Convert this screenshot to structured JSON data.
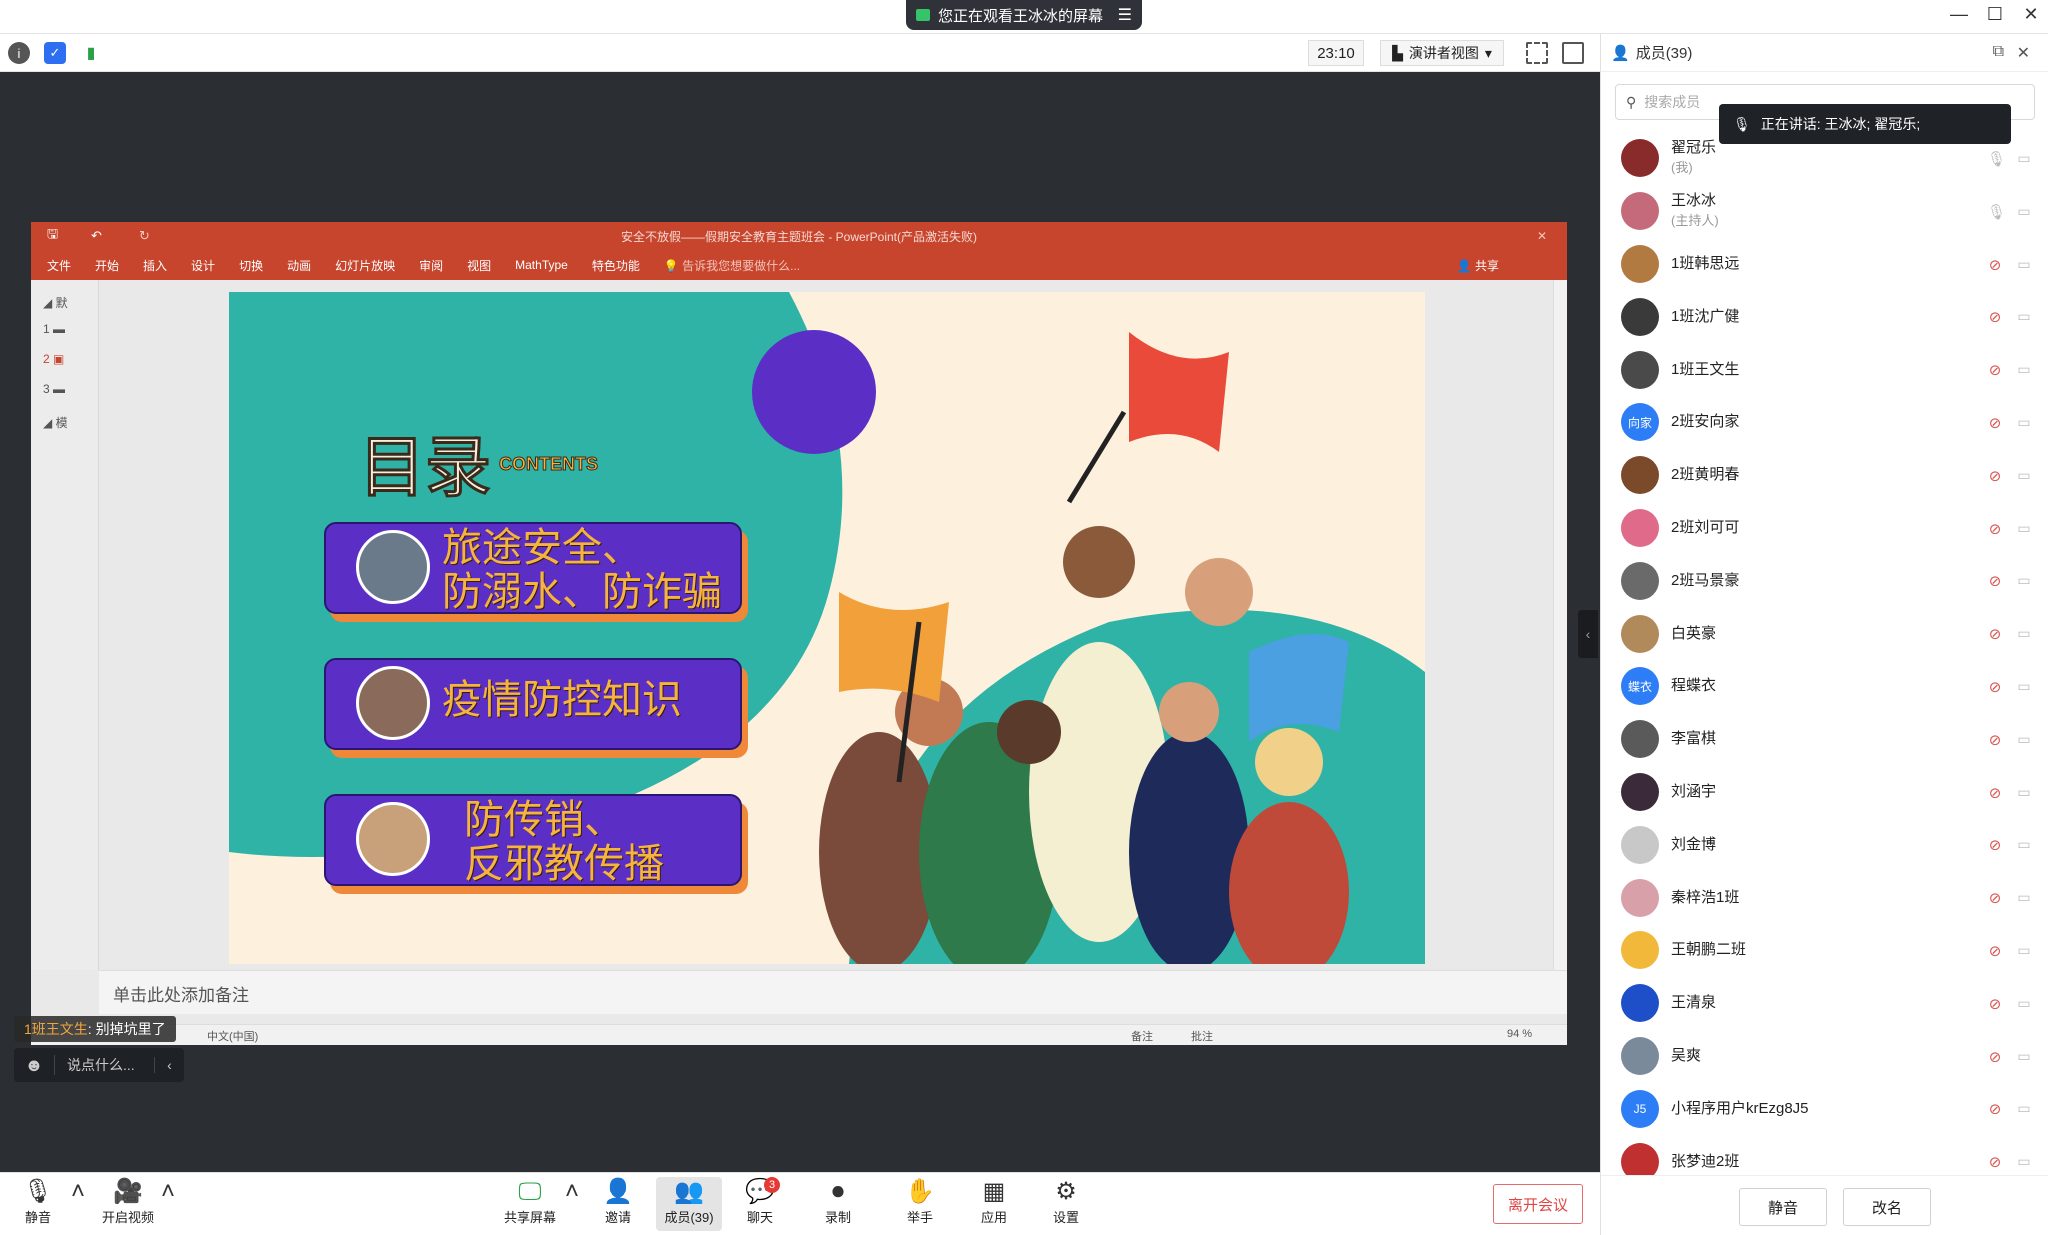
{
  "titlebar": {
    "share_status": "您正在观看王冰冰的屏幕"
  },
  "toolbar": {
    "timer": "23:10",
    "view_mode": "演讲者视图"
  },
  "panel": {
    "title": "成员(39)",
    "search_placeholder": "搜索成员",
    "speaking_label": "正在讲话: 王冰冰; 翟冠乐;",
    "members": [
      {
        "name": "翟冠乐",
        "tag": "(我)",
        "color": "#8a2b2b"
      },
      {
        "name": "王冰冰",
        "tag": "(主持人)",
        "color": "#c46a7a"
      },
      {
        "name": "1班韩思远",
        "tag": "",
        "color": "#b07a40"
      },
      {
        "name": "1班沈广健",
        "tag": "",
        "color": "#3a3a3a"
      },
      {
        "name": "1班王文生",
        "tag": "",
        "color": "#4a4a4a"
      },
      {
        "name": "2班安向家",
        "tag": "",
        "color": "#2d7df6",
        "initials": "向家"
      },
      {
        "name": "2班黄明春",
        "tag": "",
        "color": "#7a4a2a"
      },
      {
        "name": "2班刘可可",
        "tag": "",
        "color": "#e06a8a"
      },
      {
        "name": "2班马景豪",
        "tag": "",
        "color": "#6a6a6a"
      },
      {
        "name": "白英豪",
        "tag": "",
        "color": "#b08a5a"
      },
      {
        "name": "程蝶衣",
        "tag": "",
        "color": "#2d7df6",
        "initials": "蝶衣"
      },
      {
        "name": "李富棋",
        "tag": "",
        "color": "#5a5a5a"
      },
      {
        "name": "刘涵宇",
        "tag": "",
        "color": "#3a2a3a"
      },
      {
        "name": "刘金博",
        "tag": "",
        "color": "#c8c8c8"
      },
      {
        "name": "秦梓浩1班",
        "tag": "",
        "color": "#d8a0a8"
      },
      {
        "name": "王朝鹏二班",
        "tag": "",
        "color": "#f1b83a"
      },
      {
        "name": "王清泉",
        "tag": "",
        "color": "#1f4fc8"
      },
      {
        "name": "吴爽",
        "tag": "",
        "color": "#7a8a9a"
      },
      {
        "name": "小程序用户krEzg8J5",
        "tag": "",
        "color": "#2d7df6",
        "initials": "J5"
      },
      {
        "name": "张梦迪2班",
        "tag": "",
        "color": "#c03030"
      }
    ],
    "mute_button": "静音",
    "rename_button": "改名"
  },
  "ppt": {
    "window_title": "安全不放假——假期安全教育主题班会 - PowerPoint(产品激活失败)",
    "menu": [
      "文件",
      "开始",
      "插入",
      "设计",
      "切换",
      "动画",
      "幻灯片放映",
      "审阅",
      "视图",
      "MathType",
      "特色功能"
    ],
    "tell_me": "告诉我您想要做什么...",
    "share": "共享",
    "sections": [
      "默",
      "模"
    ],
    "slide_numbers": [
      "1",
      "2",
      "3"
    ],
    "slide": {
      "heading": "目录",
      "heading_en": "CONTENTS",
      "items": [
        {
          "line1": "旅途安全、",
          "line2": "防溺水、防诈骗"
        },
        {
          "line1": "疫情防控知识",
          "line2": ""
        },
        {
          "line1": "防传销、",
          "line2": "反邪教传播"
        }
      ]
    },
    "notes_placeholder": "单击此处添加备注",
    "status_lang": "中文(中国)",
    "status_notes": "备注",
    "status_comments": "批注",
    "zoom": "94 %"
  },
  "chat": {
    "sender": "1班王文生",
    "message": "别掉坑里了",
    "input_placeholder": "说点什么..."
  },
  "controls": {
    "mute": "静音",
    "video": "开启视频",
    "share": "共享屏幕",
    "invite": "邀请",
    "members": "成员(39)",
    "chat": "聊天",
    "chat_badge": "3",
    "record": "录制",
    "raise": "举手",
    "apps": "应用",
    "settings": "设置",
    "leave": "离开会议"
  }
}
